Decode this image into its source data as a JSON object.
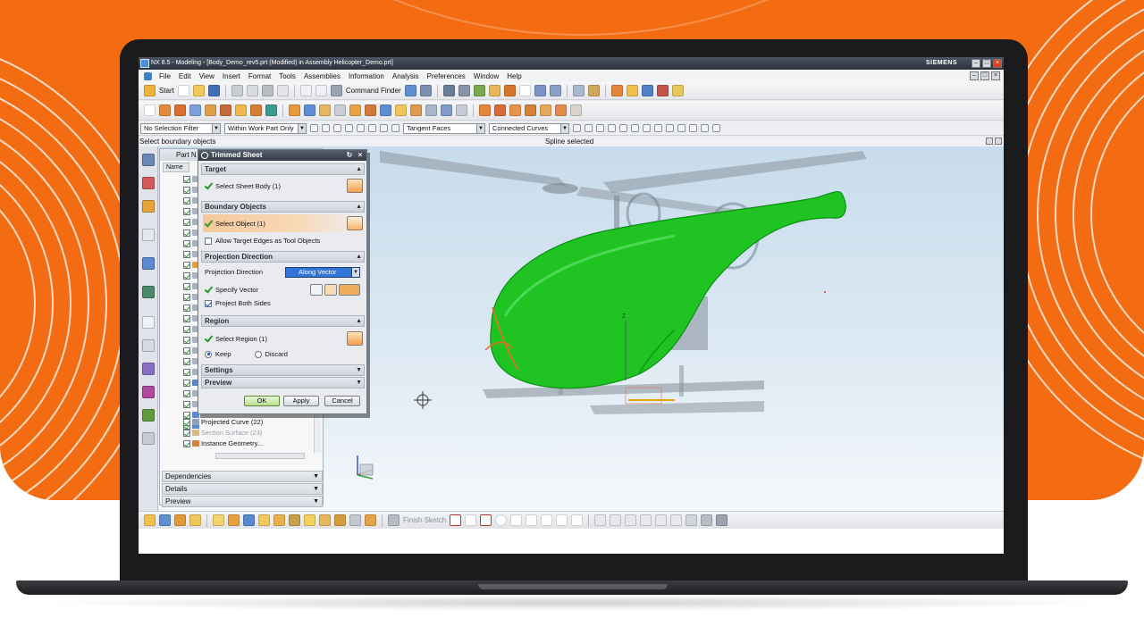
{
  "window": {
    "title": "NX 8.5 - Modeling - [Body_Demo_rev5.prt (Modified)  in Assembly Helicopter_Demo.prt]",
    "brand": "SIEMENS"
  },
  "menu": [
    "File",
    "Edit",
    "View",
    "Insert",
    "Format",
    "Tools",
    "Assemblies",
    "Information",
    "Analysis",
    "Preferences",
    "Window",
    "Help"
  ],
  "toolbar": {
    "start_label": "Start",
    "command_finder_label": "Command Finder"
  },
  "selection_bar": {
    "filter": "No Selection Filter",
    "scope": "Within Work Part Only",
    "face_rule": "Tangent Faces",
    "curve_rule": "Connected Curves"
  },
  "status": {
    "prompt": "Select boundary objects",
    "message": "Spline selected"
  },
  "navigator": {
    "title": "Part N",
    "column_name": "Name",
    "items": [
      {
        "label": "Projected Curve (22)"
      },
      {
        "label": "Section Surface (23)"
      },
      {
        "label": "Instance Geometry..."
      }
    ],
    "panels": [
      "Dependencies",
      "Details",
      "Preview"
    ]
  },
  "dialog": {
    "title": "Trimmed Sheet",
    "groups": {
      "target": "Target",
      "boundary": "Boundary Objects",
      "projection": "Projection Direction",
      "region": "Region",
      "settings": "Settings",
      "preview": "Preview"
    },
    "select_sheet_body": "Select Sheet Body (1)",
    "select_object": "Select Object (1)",
    "allow_target_edges": "Allow Target Edges as Tool Objects",
    "projection_direction_label": "Projection Direction",
    "projection_direction_value": "Along Vector",
    "specify_vector": "Specify Vector",
    "project_both_sides": "Project Both Sides",
    "select_region": "Select Region (1)",
    "keep": "Keep",
    "discard": "Discard",
    "ok": "OK",
    "apply": "Apply",
    "cancel": "Cancel"
  },
  "sketch_bar": {
    "finish_sketch": "Finish Sketch"
  },
  "colors": {
    "accent_orange": "#f36c12",
    "model_green": "#18c21e",
    "title_bar": "#343b45"
  }
}
